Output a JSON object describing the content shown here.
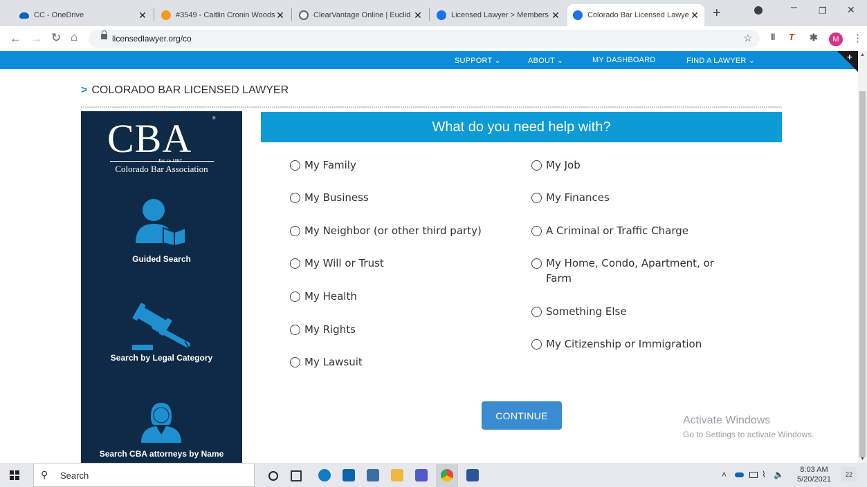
{
  "browser": {
    "tabs": [
      {
        "title": "CC - OneDrive",
        "icon": "onedrive-icon",
        "color": "#0364b8"
      },
      {
        "title": "#3549 - Caitlin Cronin Woods",
        "icon": "clio-icon",
        "color": "#f29c1f"
      },
      {
        "title": "ClearVantage Online | Euclid T",
        "icon": "globe-icon",
        "color": "#5f6368"
      },
      {
        "title": "Licensed Lawyer > Members",
        "icon": "shield-icon",
        "color": "#1a73e8"
      },
      {
        "title": "Colorado Bar Licensed Lawye",
        "icon": "shield-icon",
        "color": "#1a73e8"
      }
    ],
    "tab_close": "✕",
    "new_tab": "+",
    "url": "licensedlawyer.org/co",
    "profile_initial": "M"
  },
  "site_nav": {
    "items": [
      "SUPPORT ⌄",
      "ABOUT ⌄",
      "MY DASHBOARD",
      "FIND A LAWYER ⌄"
    ],
    "corner": "+"
  },
  "breadcrumb": {
    "chevron": ">",
    "text": "COLORADO BAR LICENSED LAWYER"
  },
  "sidebar": {
    "logo": "CBA",
    "logo_mark": "®",
    "est": "Est. in 1897",
    "association": "Colorado Bar Association",
    "items": [
      {
        "label": "Guided Search",
        "icon": "person-book-icon"
      },
      {
        "label": "Search by Legal Category",
        "icon": "gavel-icon"
      },
      {
        "label": "Search CBA attorneys by Name",
        "icon": "attorney-icon"
      }
    ]
  },
  "question": {
    "header": "What do you need help with?",
    "left_options": [
      "My Family",
      "My Business",
      "My Neighbor (or other third party)",
      "My Will or Trust",
      "My Health",
      "My Rights",
      "My Lawsuit"
    ],
    "right_options": [
      "My Job",
      "My Finances",
      "A Criminal or Traffic Charge",
      "My Home, Condo, Apartment, or Farm",
      "Something Else",
      "My Citizenship or Immigration"
    ],
    "continue": "CONTINUE"
  },
  "watermark": {
    "line1": "Activate Windows",
    "line2": "Go to Settings to activate Windows."
  },
  "taskbar": {
    "search": "Search",
    "time": "8:03 AM",
    "date": "5/20/2021",
    "notifications": "22"
  },
  "colors": {
    "nav_blue": "#0d8dd9",
    "header_blue": "#0d9bd6",
    "sidebar_navy": "#0f2a46",
    "icon_blue": "#1e8fcf",
    "button_blue": "#3a8cd0"
  }
}
